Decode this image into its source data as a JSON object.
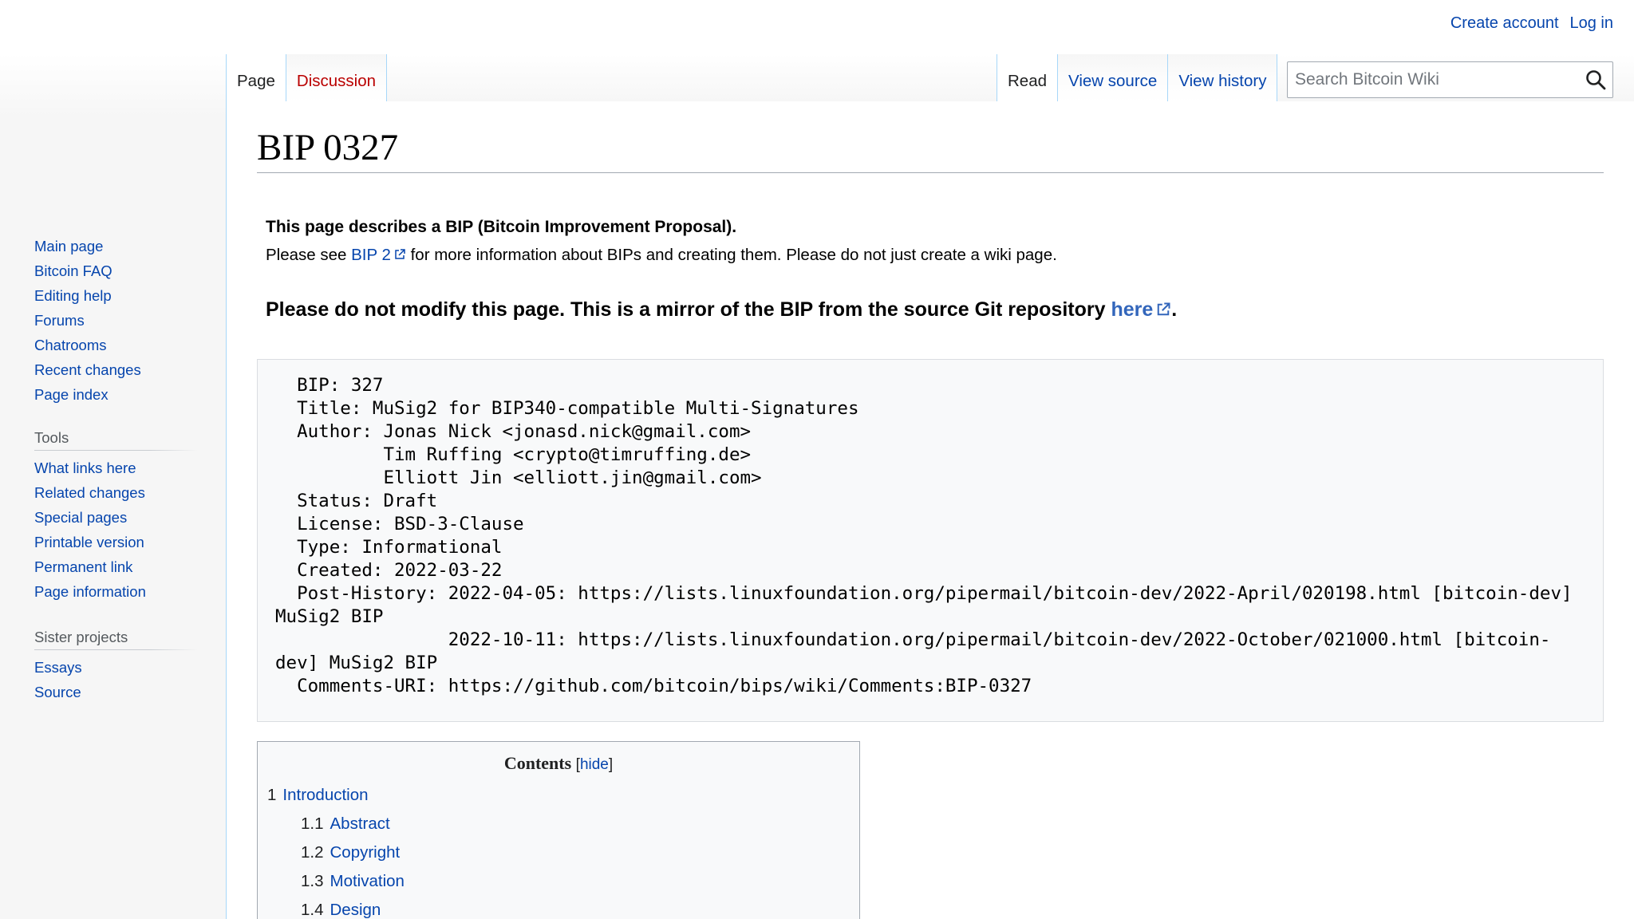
{
  "personal": {
    "create_account": "Create account",
    "log_in": "Log in"
  },
  "navigation": {
    "items": [
      "Main page",
      "Bitcoin FAQ",
      "Editing help",
      "Forums",
      "Chatrooms",
      "Recent changes",
      "Page index"
    ]
  },
  "tools": {
    "heading": "Tools",
    "items": [
      "What links here",
      "Related changes",
      "Special pages",
      "Printable version",
      "Permanent link",
      "Page information"
    ]
  },
  "sister": {
    "heading": "Sister projects",
    "items": [
      "Essays",
      "Source"
    ]
  },
  "tabs": {
    "page": "Page",
    "discussion": "Discussion",
    "read": "Read",
    "view_source": "View source",
    "view_history": "View history"
  },
  "search": {
    "placeholder": "Search Bitcoin Wiki"
  },
  "page": {
    "title": "BIP 0327",
    "notice_bold": "This page describes a BIP (Bitcoin Improvement Proposal).",
    "notice_pre": "Please see ",
    "notice_link": "BIP 2",
    "notice_post": " for more information about BIPs and creating them. Please do not just create a wiki page.",
    "mirror_text": "Please do not modify this page. This is a mirror of the BIP from the source Git repository ",
    "mirror_link": "here",
    "mirror_end": "."
  },
  "header_block": "  BIP: 327\n  Title: MuSig2 for BIP340-compatible Multi-Signatures\n  Author: Jonas Nick <jonasd.nick@gmail.com>\n          Tim Ruffing <crypto@timruffing.de>\n          Elliott Jin <elliott.jin@gmail.com>\n  Status: Draft\n  License: BSD-3-Clause\n  Type: Informational\n  Created: 2022-03-22\n  Post-History: 2022-04-05: https://lists.linuxfoundation.org/pipermail/bitcoin-dev/2022-April/020198.html [bitcoin-dev]\nMuSig2 BIP\n                2022-10-11: https://lists.linuxfoundation.org/pipermail/bitcoin-dev/2022-October/021000.html [bitcoin-\ndev] MuSig2 BIP\n  Comments-URI: https://github.com/bitcoin/bips/wiki/Comments:BIP-0327",
  "toc": {
    "title": "Contents",
    "hide_label": "hide",
    "items": [
      {
        "num": "1",
        "label": "Introduction",
        "level": 1
      },
      {
        "num": "1.1",
        "label": "Abstract",
        "level": 2
      },
      {
        "num": "1.2",
        "label": "Copyright",
        "level": 2
      },
      {
        "num": "1.3",
        "label": "Motivation",
        "level": 2
      },
      {
        "num": "1.4",
        "label": "Design",
        "level": 2
      }
    ]
  }
}
